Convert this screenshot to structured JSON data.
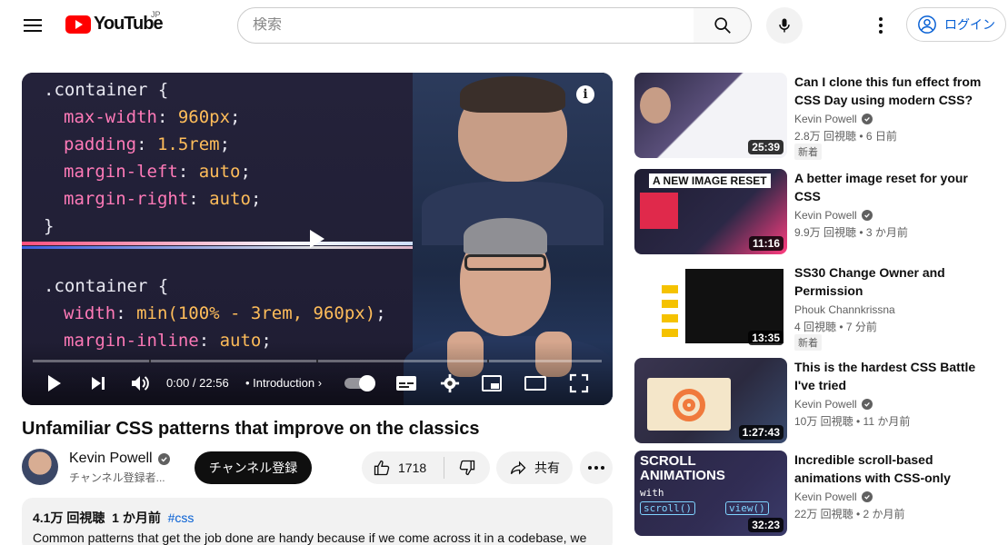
{
  "header": {
    "logo_text": "YouTube",
    "region": "JP",
    "search_placeholder": "検索",
    "login_label": "ログイン"
  },
  "player": {
    "code_top": [
      [
        ".container {",
        "sel"
      ],
      [
        "max-width",
        "960px"
      ],
      [
        "padding",
        "1.5rem"
      ],
      [
        "margin-left",
        "auto"
      ],
      [
        "margin-right",
        "auto"
      ],
      [
        "}",
        "sel"
      ]
    ],
    "code_bottom": [
      [
        ".container {",
        "sel"
      ],
      [
        "width",
        "min(100% - 3rem, 960px)"
      ],
      [
        "margin-inline",
        "auto"
      ]
    ],
    "time": "0:00 / 22:56",
    "chapter": "Introduction",
    "info_glyph": "i",
    "progress_value": 0
  },
  "video": {
    "title": "Unfamiliar CSS patterns that improve on the classics",
    "channel": "Kevin Powell",
    "subscribers": "チャンネル登録者...",
    "subscribe_label": "チャンネル登録",
    "likes": "1718",
    "share_label": "共有",
    "views": "4.1万 回視聴",
    "date": "1 か月前",
    "hashtag": "#css",
    "description": "Common patterns that get the job done are handy because if we come across it in a codebase, we"
  },
  "recommendations": [
    {
      "title": "Can I clone this fun effect from CSS Day using modern CSS?",
      "channel": "Kevin Powell",
      "verified": true,
      "meta": "2.8万 回視聴 • 6 日前",
      "badge": "新着",
      "duration": "25:39",
      "theme": "clone"
    },
    {
      "title": "A better image reset for your CSS",
      "channel": "Kevin Powell",
      "verified": true,
      "meta": "9.9万 回視聴 • 3 か月前",
      "badge": "",
      "duration": "11:16",
      "theme": "reset",
      "thumb_text": "A NEW IMAGE RESET"
    },
    {
      "title": "SS30 Change Owner and Permission",
      "channel": "Phouk Channkrissna",
      "verified": false,
      "meta": "4 回視聴 • 7 分前",
      "badge": "新着",
      "duration": "13:35",
      "theme": "terminal"
    },
    {
      "title": "This is the hardest CSS Battle I've tried",
      "channel": "Kevin Powell",
      "verified": true,
      "meta": "10万 回視聴 • 11 か月前",
      "badge": "",
      "duration": "1:27:43",
      "theme": "battle"
    },
    {
      "title": "Incredible scroll-based animations with CSS-only",
      "channel": "Kevin Powell",
      "verified": true,
      "meta": "22万 回視聴 • 2 か月前",
      "badge": "",
      "duration": "32:23",
      "theme": "scroll",
      "thumb_text": "SCROLL ANIMATIONS",
      "thumb_sub": "with",
      "thumb_tags": [
        "scroll()",
        "view()"
      ]
    }
  ],
  "colors": {
    "brand_red": "#ff0000",
    "link_blue": "#065fd4",
    "text_primary": "#0f0f0f",
    "text_secondary": "#606060"
  }
}
